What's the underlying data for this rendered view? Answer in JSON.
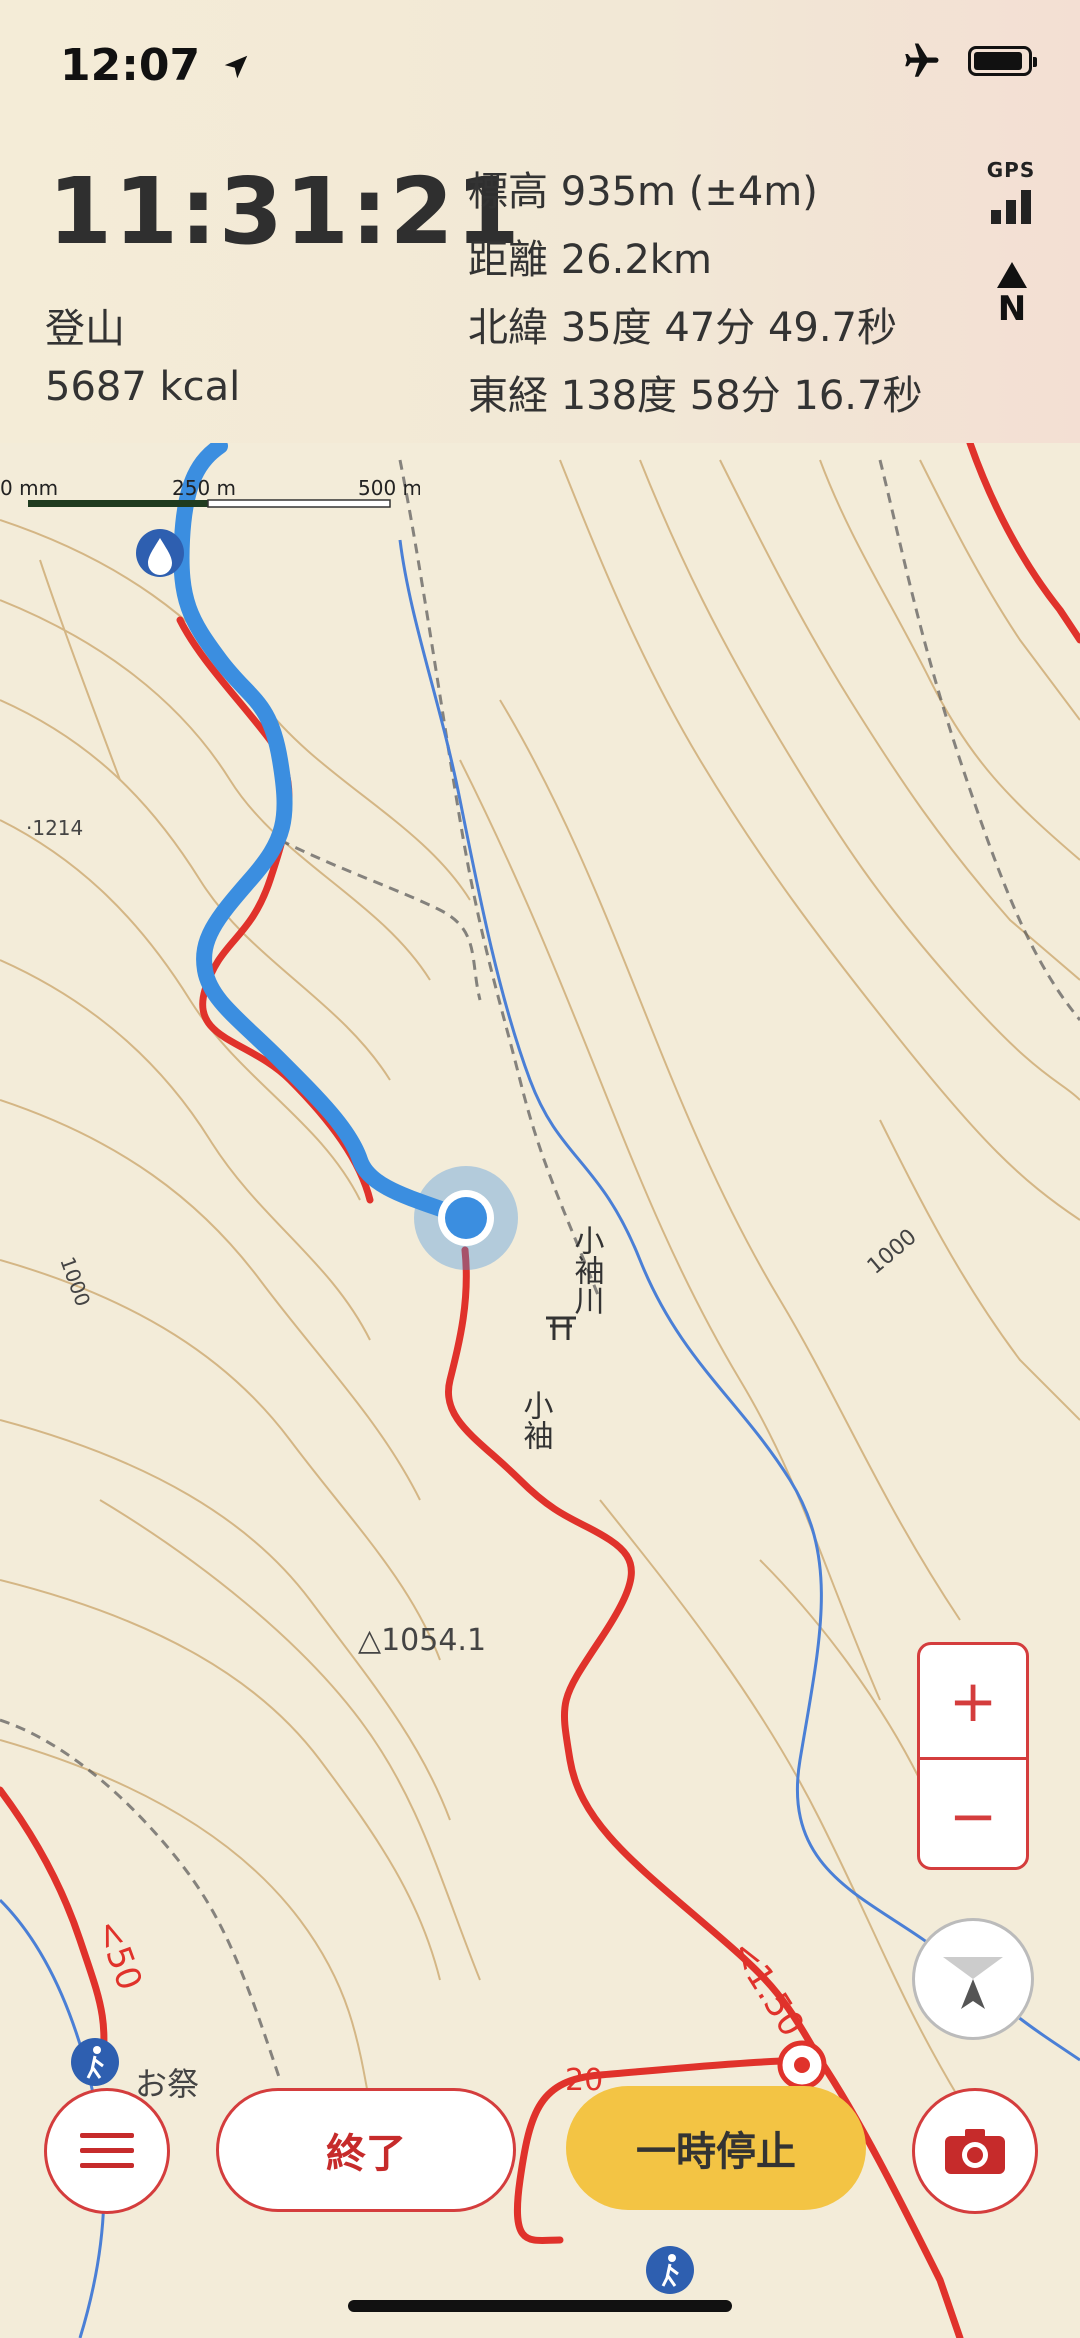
{
  "status_bar": {
    "time": "12:07"
  },
  "tracking": {
    "elapsed": "11:31:21",
    "activity": "登山",
    "calories": "5687 kcal",
    "elevation": "標高 935m (±4m)",
    "distance": "距離 26.2km",
    "latitude": "北緯 35度 47分 49.7秒",
    "longitude": "東経 138度 58分 16.7秒",
    "gps_label": "GPS",
    "north_label": "N"
  },
  "map": {
    "scale": {
      "start": "0 mm",
      "mid": "250 m",
      "end": "500 m"
    },
    "labels": {
      "spot_height_1": "·1214",
      "contour_1000_left": "1000",
      "contour_1000_right": "1000",
      "river": "小袖川",
      "village": "小袖",
      "summit": "△1054.1",
      "place": "お祭",
      "trail_time_1": "<50",
      "trail_time_2": "<1:50",
      "contour_number": "20"
    },
    "colors": {
      "track": "#3b8ee0",
      "route": "#e0322b",
      "contour": "#c9a66b",
      "water": "#4a7fd6"
    }
  },
  "controls": {
    "zoom_in": "+",
    "zoom_out": "−",
    "end_label": "終了",
    "pause_label": "一時停止"
  },
  "colors": {
    "accent": "#d43d3d",
    "pause": "#f3c444"
  }
}
